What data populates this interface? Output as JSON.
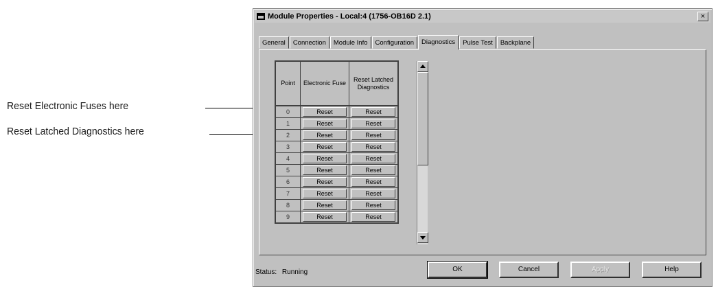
{
  "annotations": {
    "fuses": "Reset Electronic Fuses here",
    "latched": "Reset Latched Diagnostics here"
  },
  "window": {
    "title": "Module Properties - Local:4 (1756-OB16D 2.1)",
    "close_label": "×"
  },
  "tabs": [
    "General",
    "Connection",
    "Module Info",
    "Configuration",
    "Diagnostics",
    "Pulse Test",
    "Backplane"
  ],
  "active_tab": "Diagnostics",
  "grid": {
    "headers": {
      "point": "Point",
      "fuse": "Electronic Fuse",
      "latched": "Reset Latched Diagnostics"
    },
    "rows": [
      {
        "point": "0",
        "fuse": "Reset",
        "latched": "Reset"
      },
      {
        "point": "1",
        "fuse": "Reset",
        "latched": "Reset"
      },
      {
        "point": "2",
        "fuse": "Reset",
        "latched": "Reset"
      },
      {
        "point": "3",
        "fuse": "Reset",
        "latched": "Reset"
      },
      {
        "point": "4",
        "fuse": "Reset",
        "latched": "Reset"
      },
      {
        "point": "5",
        "fuse": "Reset",
        "latched": "Reset"
      },
      {
        "point": "6",
        "fuse": "Reset",
        "latched": "Reset"
      },
      {
        "point": "7",
        "fuse": "Reset",
        "latched": "Reset"
      },
      {
        "point": "8",
        "fuse": "Reset",
        "latched": "Reset"
      },
      {
        "point": "9",
        "fuse": "Reset",
        "latched": "Reset"
      }
    ]
  },
  "status": {
    "label": "Status:",
    "value": "Running"
  },
  "buttons": {
    "ok": "OK",
    "cancel": "Cancel",
    "apply": "Apply",
    "help": "Help"
  }
}
